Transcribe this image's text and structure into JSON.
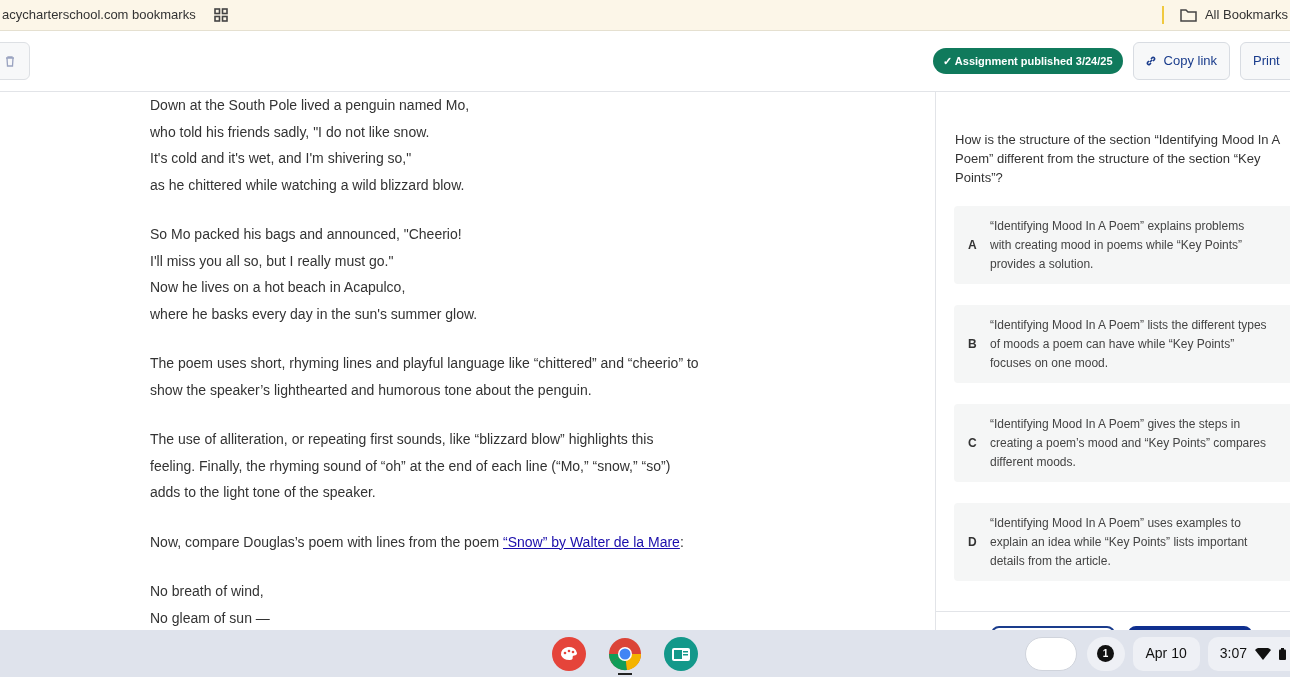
{
  "bookmarks_bar": {
    "left_label": "acycharterschool.com bookmarks",
    "right_label": "All Bookmarks"
  },
  "header": {
    "status_badge": "✓ Assignment published 3/24/25",
    "buttons": [
      "Copy link",
      "Print"
    ]
  },
  "passage": {
    "paragraphs": [
      {
        "lines": [
          "Down at the South Pole lived a penguin named Mo,",
          "who told his friends sadly, \"I do not like snow.",
          "It's cold and it's wet, and I'm shivering so,\"",
          "as he chittered while watching a wild blizzard blow."
        ]
      },
      {
        "lines": [
          "So Mo packed his bags and announced, \"Cheerio!",
          "I'll miss you all so, but I really must go.\"",
          "Now he lives on a hot beach in Acapulco,",
          "where he basks every day in the sun's summer glow."
        ]
      },
      {
        "lines": [
          "The poem uses short, rhyming lines and playful language like “chittered” and “cheerio” to",
          "show the speaker’s lighthearted and humorous tone about the penguin."
        ]
      },
      {
        "lines": [
          "The use of alliteration, or repeating first sounds, like “blizzard blow” highlights this",
          "feeling. Finally, the rhyming sound of “oh” at the end of each line (“Mo,” “snow,” “so”)",
          "adds to the light tone of the speaker."
        ]
      },
      {
        "lines": [
          "Now, compare Douglas’s poem with lines from the poem "
        ],
        "link": "“Snow” by Walter de la Mare",
        "after_link": ":"
      },
      {
        "lines": [
          "No breath of wind,",
          "No gleam of sun —"
        ]
      }
    ]
  },
  "question": {
    "prompt": "How is the structure of the section “Identifying Mood In A Poem” different from the structure of the section “Key Points”?",
    "choices": [
      {
        "letter": "A",
        "text": "“Identifying Mood In A Poem” explains problems with creating mood in poems while “Key Points” provides a solution.",
        "selected": false
      },
      {
        "letter": "B",
        "text": "“Identifying Mood In A Poem” lists the different types of moods a poem can have while “Key Points” focuses on one mood.",
        "selected": false
      },
      {
        "letter": "C",
        "text": "“Identifying Mood In A Poem” gives the steps in creating a poem’s mood and “Key Points” compares different moods.",
        "selected": false
      },
      {
        "letter": "D",
        "text": "“Identifying Mood In A Poem” uses examples to explain an idea while “Key Points” lists important details from the article.",
        "selected": false
      }
    ]
  },
  "taskbar": {
    "notification_count": "1",
    "date": "Apr 10",
    "time": "3:07"
  }
}
